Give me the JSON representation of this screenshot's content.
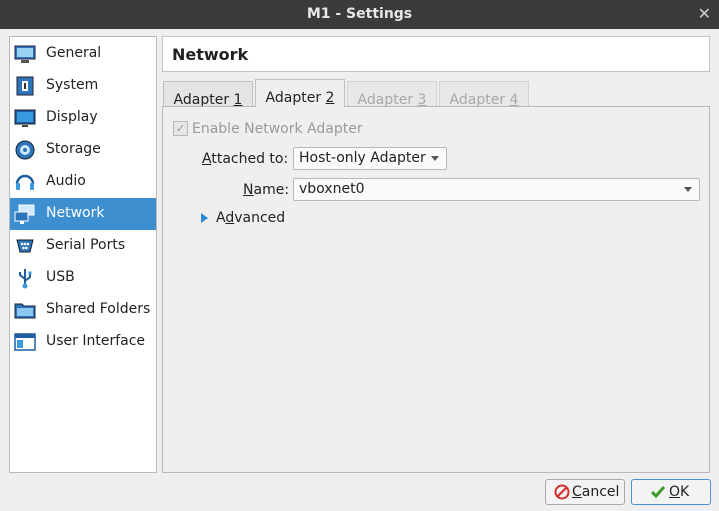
{
  "window": {
    "title": "M1 - Settings",
    "close_glyph": "✕"
  },
  "sidebar": {
    "items": [
      {
        "label": "General",
        "icon": "general-icon",
        "selected": false
      },
      {
        "label": "System",
        "icon": "system-icon",
        "selected": false
      },
      {
        "label": "Display",
        "icon": "display-icon",
        "selected": false
      },
      {
        "label": "Storage",
        "icon": "storage-icon",
        "selected": false
      },
      {
        "label": "Audio",
        "icon": "audio-icon",
        "selected": false
      },
      {
        "label": "Network",
        "icon": "network-icon",
        "selected": true
      },
      {
        "label": "Serial Ports",
        "icon": "serial-ports-icon",
        "selected": false
      },
      {
        "label": "USB",
        "icon": "usb-icon",
        "selected": false
      },
      {
        "label": "Shared Folders",
        "icon": "shared-folders-icon",
        "selected": false
      },
      {
        "label": "User Interface",
        "icon": "user-interface-icon",
        "selected": false
      }
    ]
  },
  "page": {
    "heading": "Network"
  },
  "tabs": [
    {
      "label_pre": "Adapter ",
      "label_mn": "1",
      "active": false,
      "enabled": true
    },
    {
      "label_pre": "Adapter ",
      "label_mn": "2",
      "active": true,
      "enabled": true
    },
    {
      "label_pre": "Adapter ",
      "label_mn": "3",
      "active": false,
      "enabled": false
    },
    {
      "label_pre": "Adapter ",
      "label_mn": "4",
      "active": false,
      "enabled": false
    }
  ],
  "adapter": {
    "enable_label": "Enable Network Adapter",
    "enable_checked": true,
    "attached_label_mn": "A",
    "attached_label_rest": "ttached to:",
    "attached_value": "Host-only Adapter",
    "name_label_mn": "N",
    "name_label_rest": "ame:",
    "name_value": "vboxnet0",
    "advanced_label_pre": "A",
    "advanced_label_mn": "d",
    "advanced_label_rest": "vanced"
  },
  "buttons": {
    "cancel_mn": "C",
    "cancel_rest": "ancel",
    "ok_mn": "O",
    "ok_rest": "K"
  },
  "colors": {
    "selection": "#3d8fcf",
    "accent": "#2d8bd6",
    "cancel_icon": "#d43030",
    "ok_icon": "#3a9a2a"
  }
}
